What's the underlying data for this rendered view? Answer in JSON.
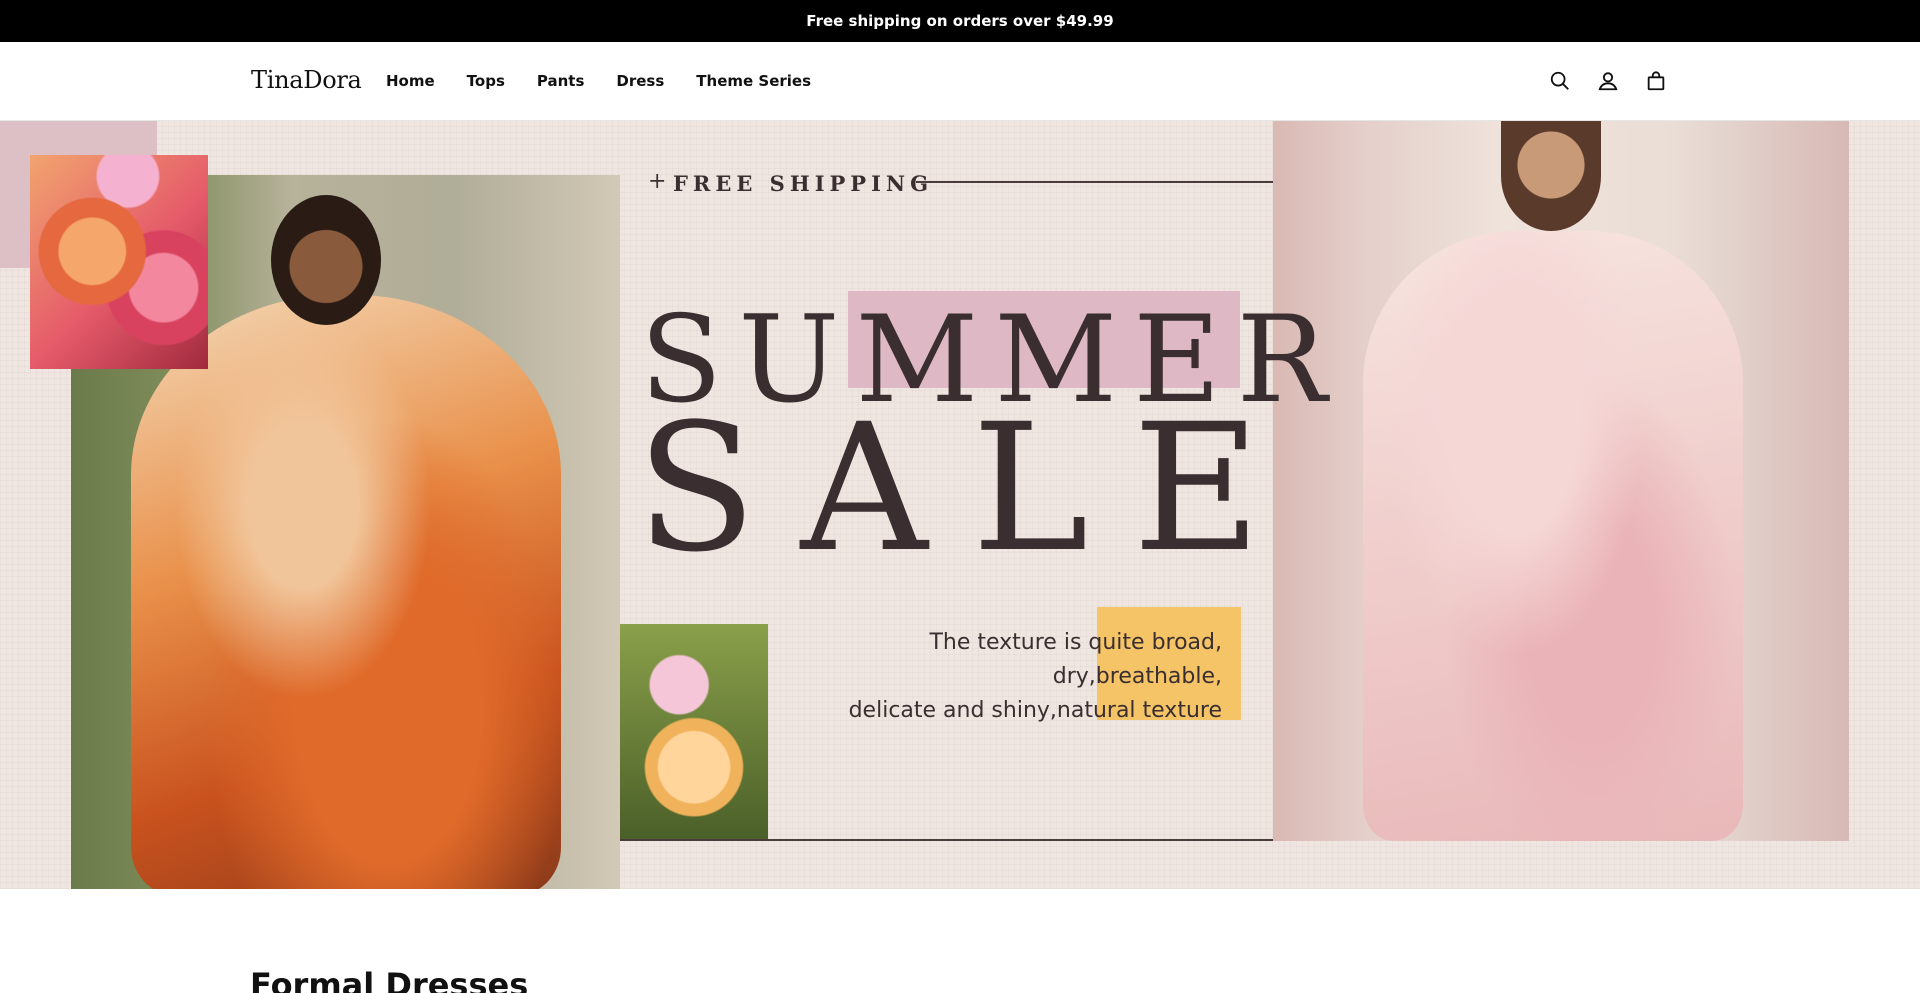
{
  "announcement": {
    "text": "Free shipping on orders over $49.99"
  },
  "header": {
    "logo": "TinaDora",
    "nav": [
      {
        "label": "Home"
      },
      {
        "label": "Tops"
      },
      {
        "label": "Pants"
      },
      {
        "label": "Dress"
      },
      {
        "label": "Theme Series"
      }
    ],
    "icons": [
      "search-icon",
      "account-icon",
      "cart-icon"
    ]
  },
  "hero": {
    "shipping_label": "FREE SHIPPING",
    "plus": "+",
    "headline_1": "SUMMER",
    "headline_2": "SALE",
    "tagline_1": "The texture is quite broad, dry,breathable,",
    "tagline_2": "delicate and shiny,natural texture"
  },
  "section": {
    "title": "Formal Dresses"
  },
  "colors": {
    "announcement_bg": "#000000",
    "hero_bg": "#f0e6e1",
    "headline": "#3a2e30",
    "pink": "#dfb8c6",
    "yellow": "#f4c466"
  }
}
